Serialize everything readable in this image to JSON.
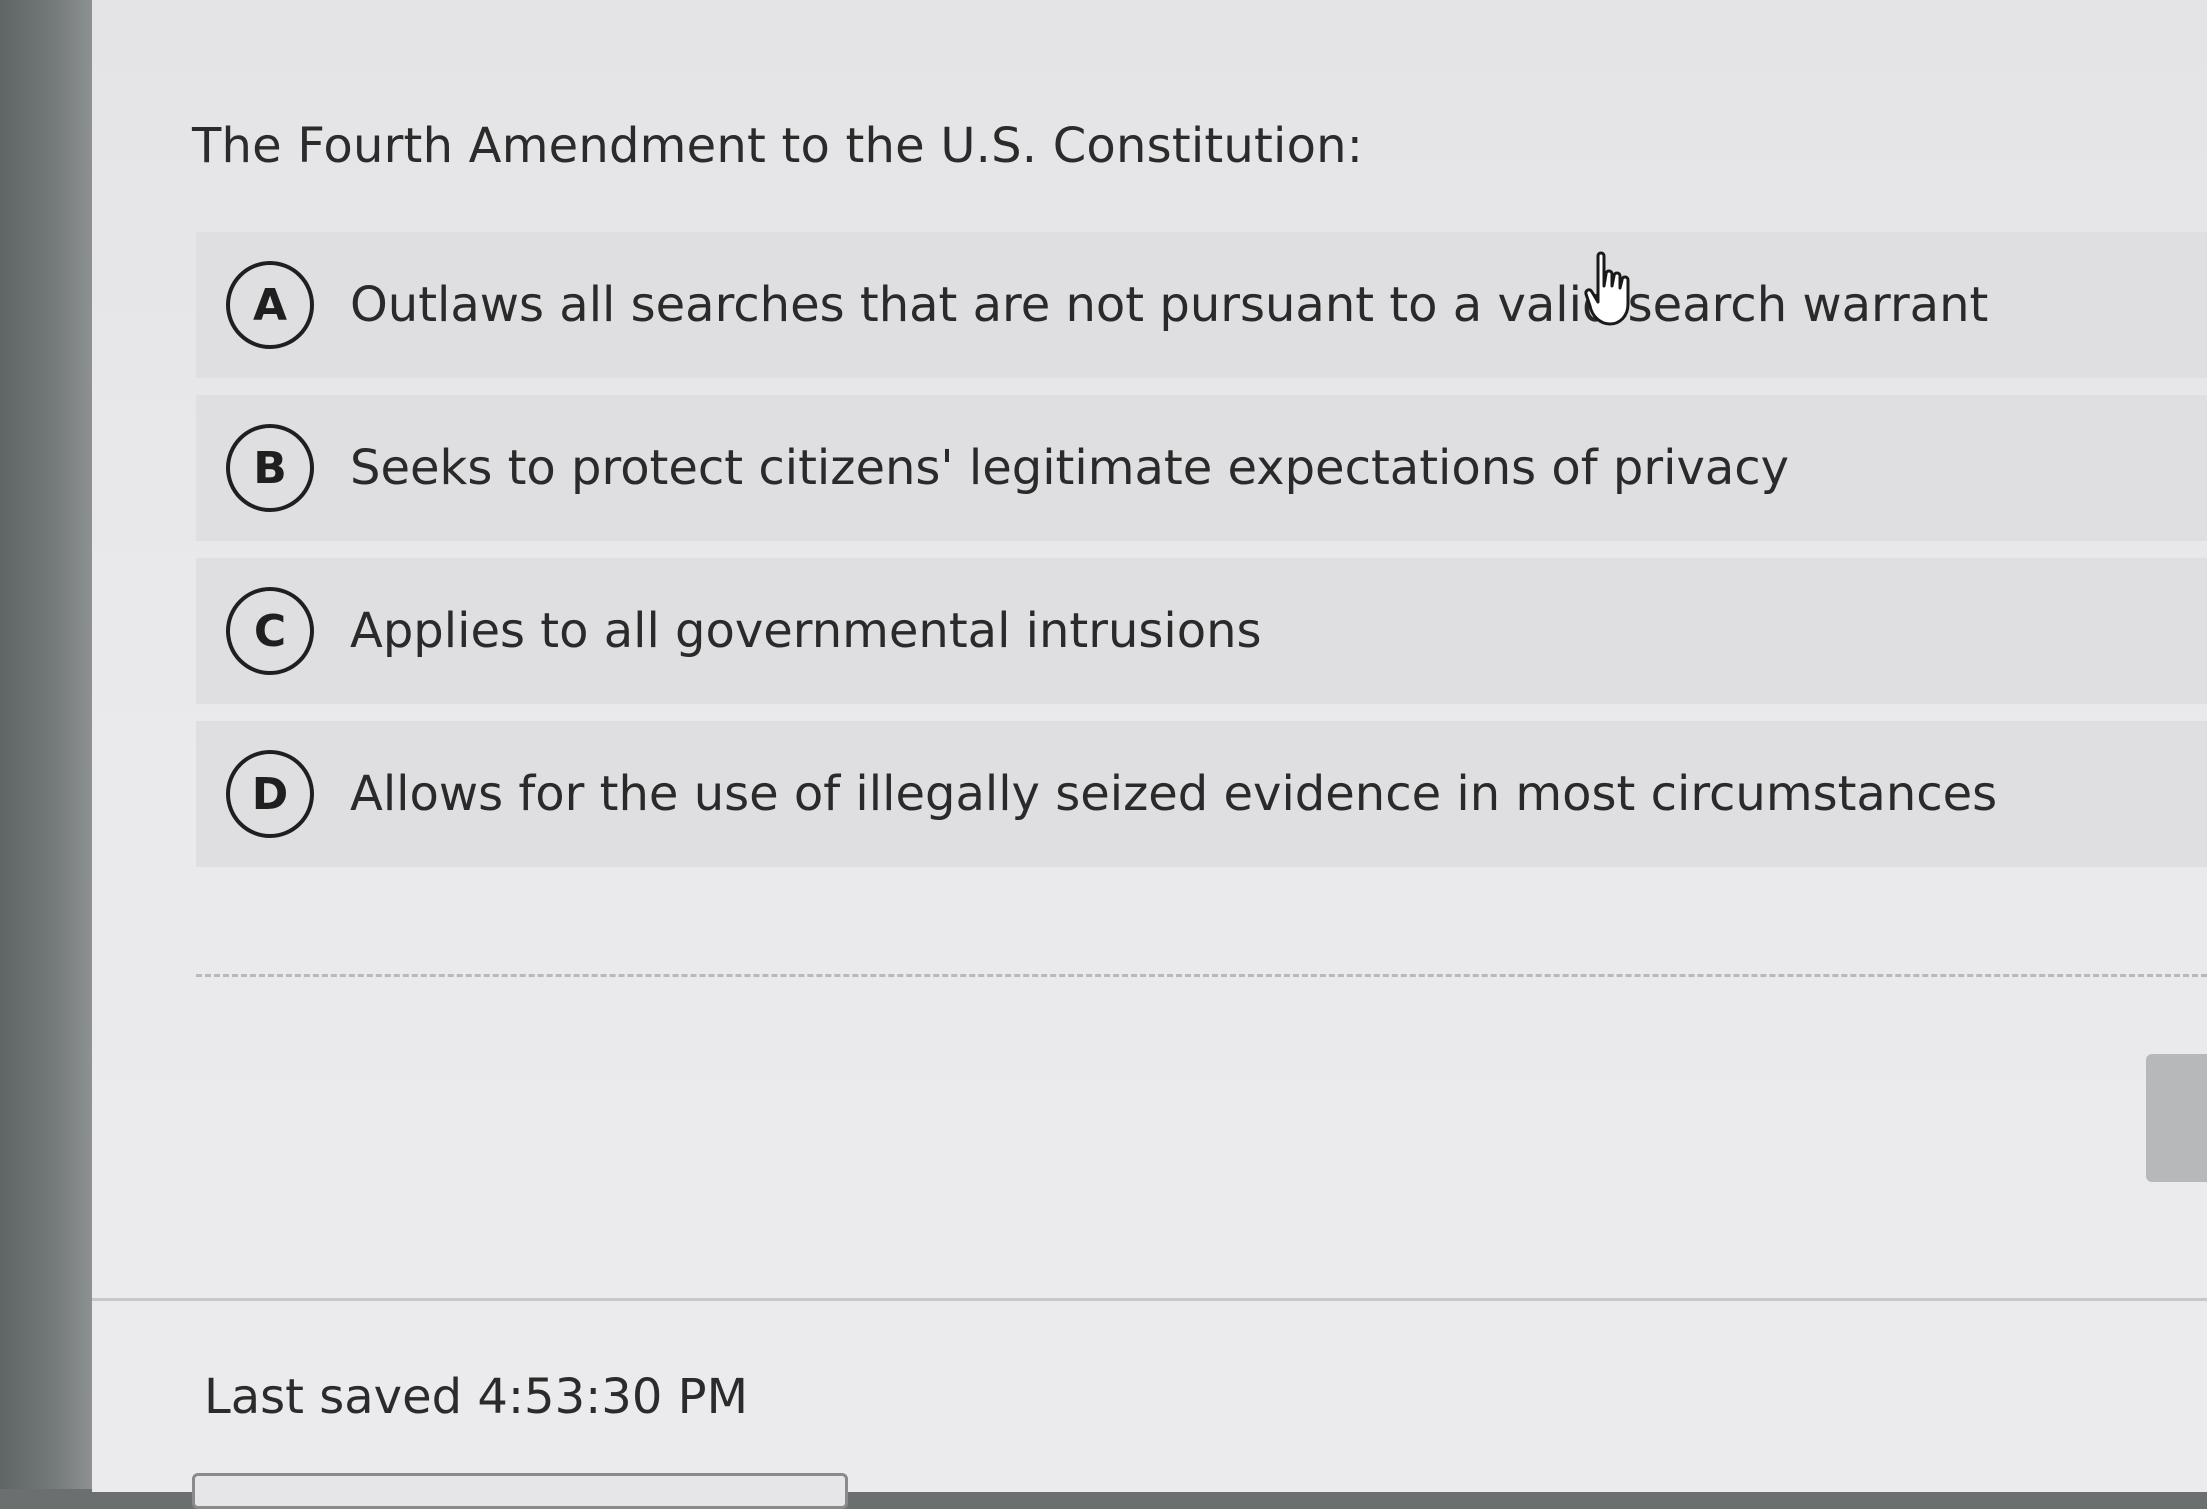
{
  "question": {
    "text": "The Fourth Amendment to the U.S. Constitution:"
  },
  "options": [
    {
      "letter": "A",
      "text": "Outlaws all searches that are not pursuant to a valid search warrant"
    },
    {
      "letter": "B",
      "text": "Seeks to protect citizens' legitimate expectations of privacy"
    },
    {
      "letter": "C",
      "text": "Applies to all governmental intrusions"
    },
    {
      "letter": "D",
      "text": "Allows for the use of illegally seized evidence in most circumstances"
    }
  ],
  "footer": {
    "last_saved": "Last saved 4:53:30 PM"
  },
  "icons": {
    "cursor": "hand-pointer-icon"
  }
}
